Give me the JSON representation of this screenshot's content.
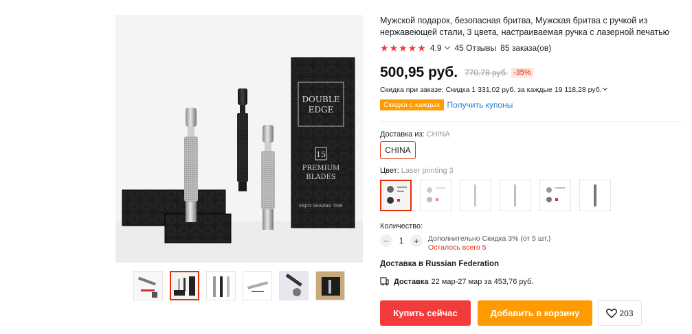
{
  "product": {
    "title": "Мужской подарок, безопасная бритва, Мужская бритва с ручкой из нержавеющей стали, 3 цвета, настраиваемая ручка с лазерной печатью",
    "rating": "4.9",
    "reviews": "45 Отзывы",
    "orders": "85 заказа(ов)",
    "price": "500,95 руб.",
    "old_price": "770,78 руб.",
    "discount": "-35%",
    "order_discount": "Скидка при заказе: Скидка 1 331,02 руб. за каждые 19 118,28 руб.",
    "coupon_badge": "Скидка с каждых",
    "coupon_link": "Получить купоны"
  },
  "gallery": {
    "box_text_1": "DOUBLE",
    "box_text_2": "EDGE",
    "box_text_3": "PREMIUM",
    "box_text_4": "BLADES",
    "box_text_5": "ENJOY SHAVING TIME",
    "box_number": "15",
    "thumbnail_count": 6,
    "active_thumbnail": 2
  },
  "shipping": {
    "label": "Доставка из:",
    "value": "CHINA",
    "option": "CHINA"
  },
  "color": {
    "label": "Цвет:",
    "value": "Laser printing 3",
    "swatch_count": 6,
    "active_swatch": 1
  },
  "quantity": {
    "label": "Количество:",
    "value": "1",
    "minus": "−",
    "plus": "+",
    "bulk_discount": "Дополнительно Скидка 3% (от 5 шт.)",
    "stock": "Осталось всего 5"
  },
  "delivery": {
    "heading": "Доставка в Russian Federation",
    "label": "Доставка",
    "details": "22 мар-27 мар за 453,76 руб."
  },
  "actions": {
    "buy": "Купить сейчас",
    "cart": "Добавить в корзину",
    "wishlist_count": "203"
  },
  "colors": {
    "accent": "#f23b3b",
    "orange": "#ff9a00",
    "link": "#2a7fd4"
  }
}
